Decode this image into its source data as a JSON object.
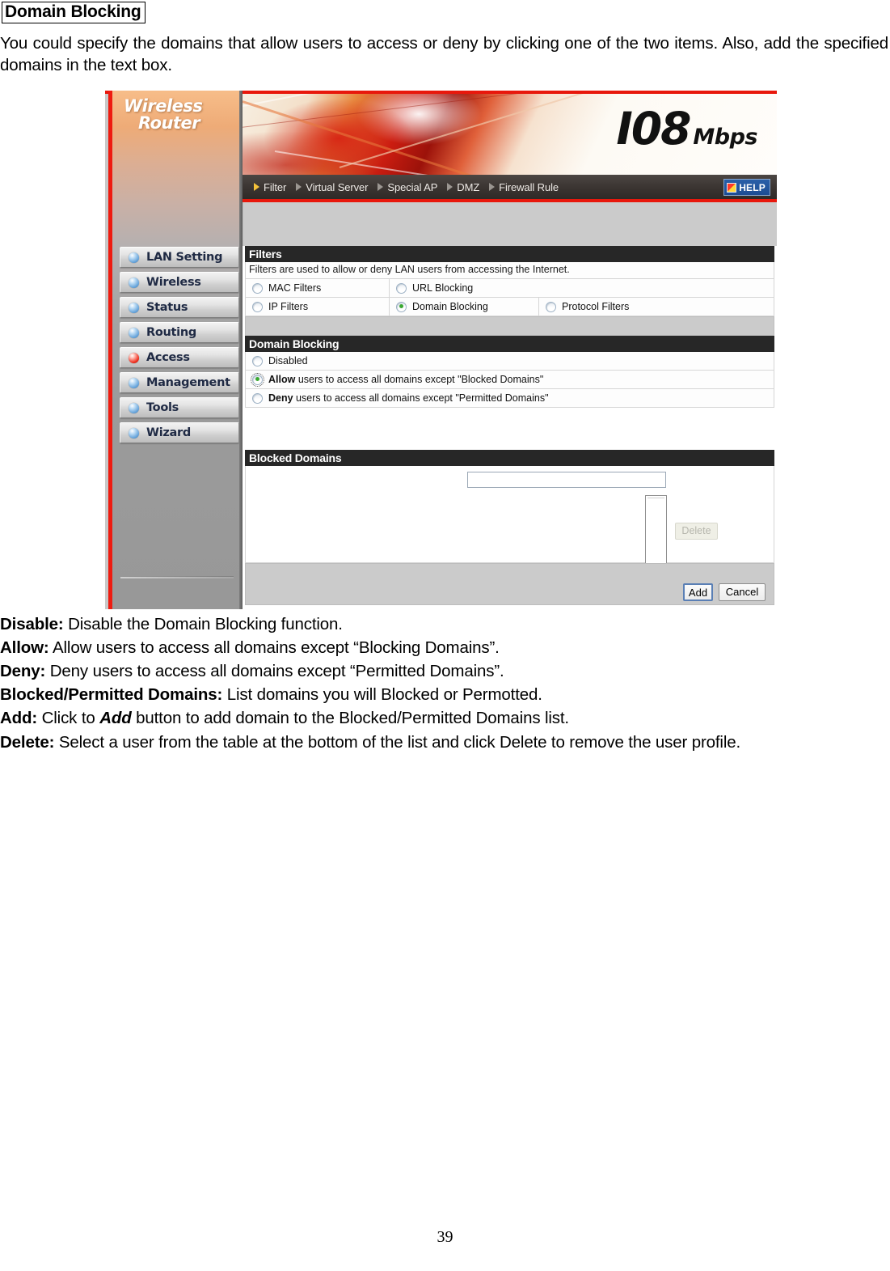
{
  "document": {
    "title": "Domain Blocking",
    "intro": "You could specify the domains that allow users to access or deny by clicking one of the two items. Also, add the specified domains in the text box.",
    "page_number": "39"
  },
  "screenshot": {
    "logo": {
      "line1": "Wireless",
      "line2": "Router"
    },
    "banner": {
      "number": "I08",
      "unit": "Mbps"
    },
    "nav": {
      "items": [
        {
          "label": "Filter",
          "active": true
        },
        {
          "label": "Virtual Server",
          "active": false
        },
        {
          "label": "Special AP",
          "active": false
        },
        {
          "label": "DMZ",
          "active": false
        },
        {
          "label": "Firewall Rule",
          "active": false
        }
      ],
      "help_label": "HELP"
    },
    "sidebar": {
      "items": [
        {
          "label": "LAN Setting",
          "active": false
        },
        {
          "label": "Wireless",
          "active": false
        },
        {
          "label": "Status",
          "active": false
        },
        {
          "label": "Routing",
          "active": false
        },
        {
          "label": "Access",
          "active": true
        },
        {
          "label": "Management",
          "active": false
        },
        {
          "label": "Tools",
          "active": false
        },
        {
          "label": "Wizard",
          "active": false
        }
      ]
    },
    "filters": {
      "heading": "Filters",
      "note": "Filters are used to allow or deny LAN users from accessing the Internet.",
      "row1": [
        {
          "label": "MAC Filters",
          "checked": false
        },
        {
          "label": "URL Blocking",
          "checked": false
        }
      ],
      "row2": [
        {
          "label": "IP Filters",
          "checked": false
        },
        {
          "label": "Domain Blocking",
          "checked": true
        },
        {
          "label": "Protocol Filters",
          "checked": false
        }
      ]
    },
    "domain_blocking": {
      "heading": "Domain Blocking",
      "options": [
        {
          "bold": "",
          "label": "Disabled",
          "checked": false,
          "focused": false
        },
        {
          "bold": "Allow",
          "label": " users to access all domains except \"Blocked Domains\"",
          "checked": true,
          "focused": true
        },
        {
          "bold": "Deny",
          "label": " users to access all domains except \"Permitted Domains\"",
          "checked": false,
          "focused": false
        }
      ]
    },
    "blocked_domains": {
      "heading": "Blocked Domains",
      "input_value": "",
      "input_placeholder": "",
      "delete_label": "Delete"
    },
    "footer": {
      "add_label": "Add",
      "cancel_label": "Cancel"
    }
  },
  "descriptions": [
    {
      "term": "Disable:",
      "text": " Disable the Domain Blocking function."
    },
    {
      "term": "Allow:",
      "text": " Allow users to access all domains except “Blocking Domains”."
    },
    {
      "term": "Deny:",
      "text": " Deny users to access all domains except “Permitted Domains”."
    },
    {
      "term": "Blocked/Permitted Domains:",
      "text": " List domains you will Blocked or Permotted."
    },
    {
      "term": "Add:",
      "text_before": " Click to ",
      "emphasis": "Add",
      "text_after": " button to add domain to the Blocked/Permitted Domains list."
    },
    {
      "term": "Delete:",
      "text": " Select a user from the table at the bottom of the list and click Delete to remove the user profile."
    }
  ]
}
